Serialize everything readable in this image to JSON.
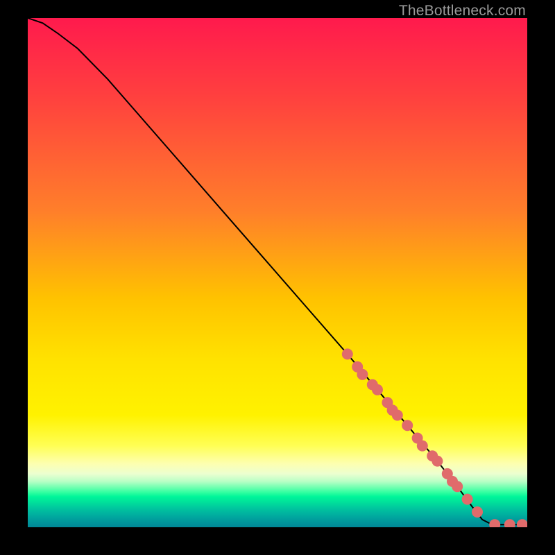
{
  "watermark": "TheBottleneck.com",
  "colors": {
    "marker": "#e06b6b",
    "curve": "#000000",
    "frame": "#000000"
  },
  "chart_data": {
    "type": "line",
    "title": "",
    "xlabel": "",
    "ylabel": "",
    "xlim": [
      0,
      100
    ],
    "ylim": [
      0,
      100
    ],
    "grid": false,
    "series": [
      {
        "name": "curve",
        "x": [
          0,
          3,
          6,
          10,
          16,
          24,
          32,
          40,
          48,
          56,
          64,
          70,
          76,
          82,
          86,
          89,
          91,
          93,
          96,
          98,
          100
        ],
        "y": [
          100,
          99,
          97,
          94,
          88,
          79,
          70,
          61,
          52,
          43,
          34,
          27,
          20,
          13,
          8,
          4,
          1.5,
          0.5,
          0.5,
          0.5,
          0.5
        ]
      }
    ],
    "markers": {
      "name": "highlighted-points",
      "x": [
        64,
        66,
        67,
        69,
        70,
        72,
        73,
        74,
        76,
        78,
        79,
        81,
        82,
        84,
        85,
        86,
        88,
        90,
        93.5,
        96.5,
        99
      ],
      "y": [
        34,
        31.5,
        30,
        28,
        27,
        24.5,
        23,
        22,
        20,
        17.5,
        16,
        14,
        13,
        10.5,
        9,
        8,
        5.5,
        3,
        0.5,
        0.5,
        0.5
      ]
    }
  }
}
